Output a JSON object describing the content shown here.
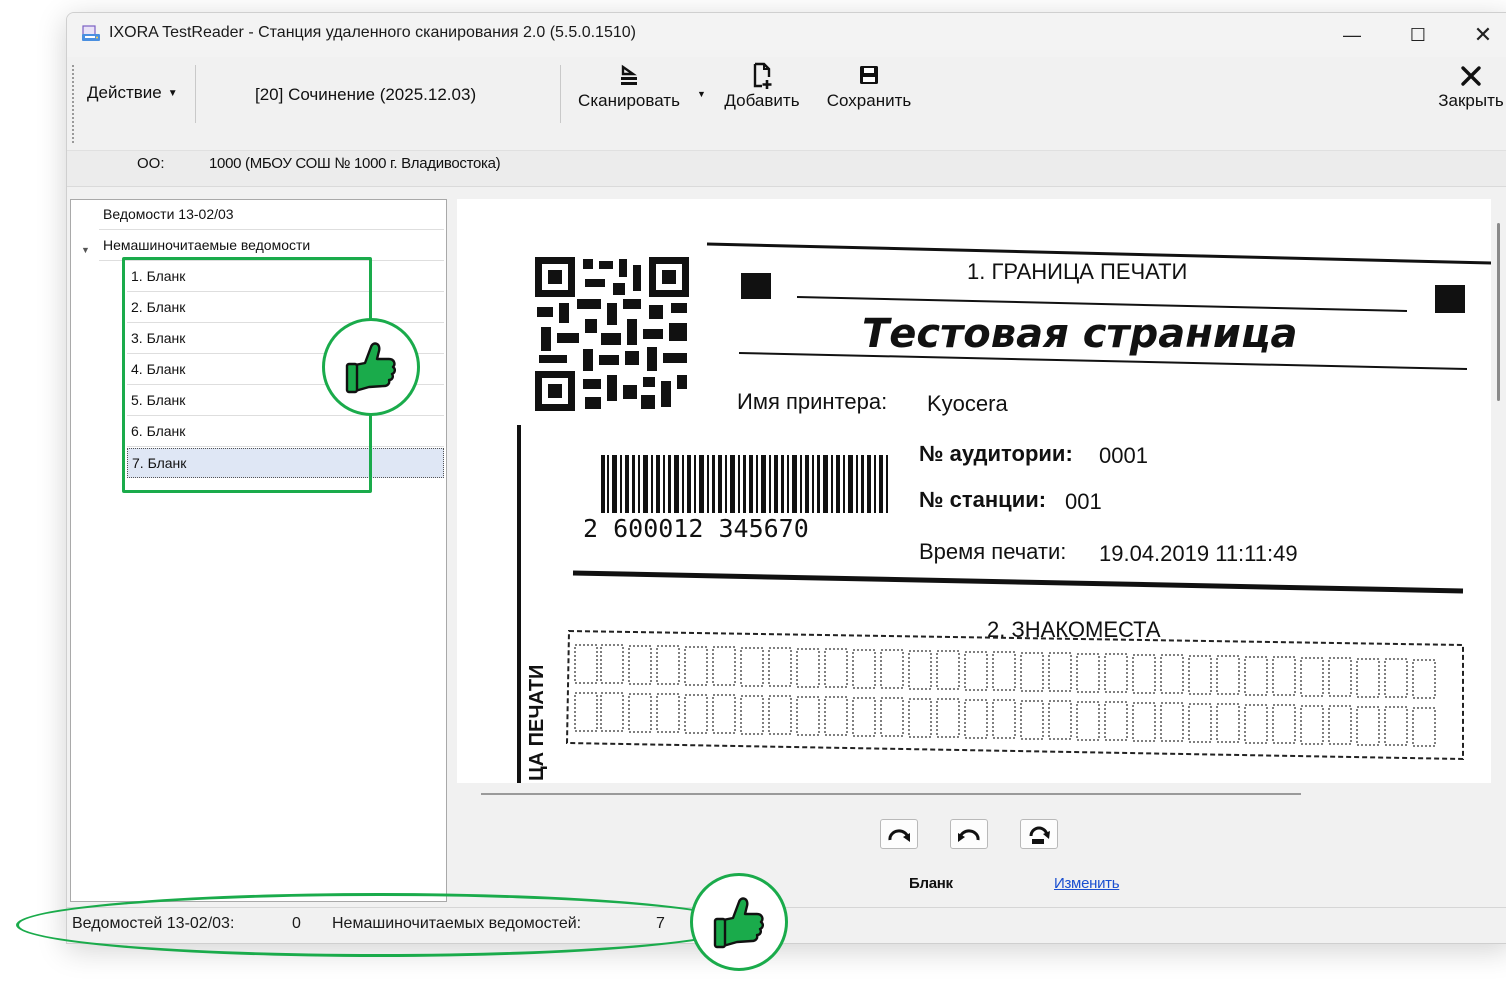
{
  "window": {
    "title": "IXORA TestReader - Станция удаленного сканирования 2.0 (5.5.0.1510)",
    "controls": {
      "minimize": "—",
      "maximize": "☐",
      "close": "✕"
    }
  },
  "toolbar": {
    "action_label": "Действие",
    "subject": "[20] Сочинение (2025.12.03)",
    "scan_label": "Сканировать",
    "add_label": "Добавить",
    "save_label": "Сохранить",
    "close_label": "Закрыть"
  },
  "info": {
    "oo_label": "ОО:",
    "oo_value": "1000 (МБОУ СОШ № 1000 г. Владивостока)"
  },
  "tree": {
    "items": [
      {
        "label": "Ведомости 13-02/03"
      },
      {
        "label": "Немашиночитаемые ведомости",
        "expanded": true
      }
    ],
    "children": [
      {
        "label": "1. Бланк"
      },
      {
        "label": "2. Бланк"
      },
      {
        "label": "3. Бланк"
      },
      {
        "label": "4. Бланк"
      },
      {
        "label": "5. Бланк"
      },
      {
        "label": "6. Бланк"
      },
      {
        "label": "7. Бланк",
        "selected": true
      }
    ]
  },
  "document": {
    "border_title": "1. ГРАНИЦА ПЕЧАТИ",
    "heading": "Тестовая страница",
    "printer_label": "Имя принтера:",
    "printer_value": "Kyocera",
    "room_label": "№ аудитории:",
    "room_value": "0001",
    "station_label": "№ станции:",
    "station_value": "001",
    "time_label": "Время печати:",
    "time_value": "19.04.2019 11:11:49",
    "barcode_number": "2 600012 345670",
    "section2_title": "2. ЗНАКОМЕСТА",
    "side_text": "ЦА ПЕЧАТИ"
  },
  "viewer_controls": {
    "blank_label": "Бланк",
    "change_link": "Изменить"
  },
  "status": {
    "vedomosti_label": "Ведомостей 13-02/03:",
    "vedomosti_count": "0",
    "nonmachine_label": "Немашиночитаемых ведомостей:",
    "nonmachine_count": "7"
  },
  "colors": {
    "highlight": "#1aab4b",
    "link": "#1a4fd0",
    "selection": "#dfe7f5"
  },
  "icons": {
    "app": "scanner-app-icon",
    "scan": "scanner-icon",
    "add": "add-page-icon",
    "save": "floppy-icon",
    "close": "close-x-icon",
    "rotate_cw": "rotate-clockwise-icon",
    "rotate_ccw": "rotate-counterclockwise-icon",
    "rotate_180": "rotate-180-icon",
    "annotation": "thumbs-up-icon"
  }
}
